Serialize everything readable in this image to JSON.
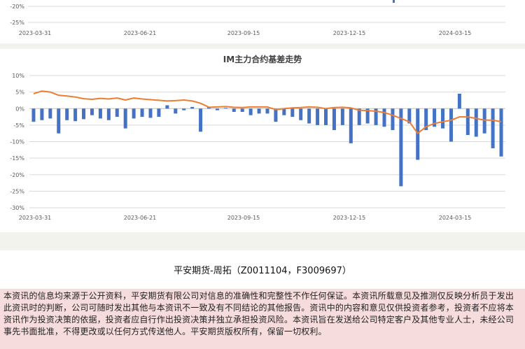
{
  "top_chart": {
    "ytick_labels": [
      "-20%",
      "-25%"
    ],
    "xtick_labels": [
      "2023-03-31",
      "2023-06-21",
      "2023-09-15",
      "2023-12-15",
      "2024-03-15"
    ]
  },
  "chart_data": {
    "type": "bar",
    "title": "IM主力合约基差走势",
    "xlabel": "",
    "ylabel": "",
    "ylim": [
      -30,
      10
    ],
    "grid": true,
    "ytick_labels": [
      "10%",
      "5%",
      "0%",
      "-5%",
      "-10%",
      "-15%",
      "-20%",
      "-25%",
      "-30%"
    ],
    "xtick_labels": [
      "2023-03-31",
      "2023-06-21",
      "2023-09-15",
      "2023-12-15",
      "2024-03-15"
    ],
    "series": [
      {
        "type": "bar",
        "color": "#4472c4",
        "values": [
          -4.0,
          -3.5,
          -3.0,
          -7.5,
          -3.5,
          -3.8,
          -3.2,
          -2.0,
          -3.0,
          -3.5,
          -2.5,
          -6.0,
          -3.0,
          -2.5,
          -2.8,
          -2.5,
          1.0,
          -1.5,
          -0.5,
          0.5,
          -7.0,
          0.5,
          -0.5,
          0.2,
          -1.0,
          -1.0,
          -2.0,
          -1.5,
          -1.5,
          -4.0,
          -2.0,
          -2.5,
          -3.5,
          -4.5,
          -5.0,
          -5.0,
          -6.5,
          -5.0,
          -10.5,
          -5.0,
          -4.5,
          -5.0,
          -5.5,
          -6.5,
          -23.5,
          -4.5,
          -15.5,
          -6.5,
          -5.5,
          -6.0,
          -10.0,
          4.5,
          -8.0,
          -8.5,
          -7.5,
          -12.0,
          -14.5
        ]
      },
      {
        "type": "line",
        "color": "#ed7d31",
        "values": [
          4.5,
          5.3,
          5.0,
          4.0,
          3.8,
          3.5,
          3.0,
          2.8,
          3.1,
          2.9,
          3.2,
          2.6,
          3.2,
          2.9,
          2.7,
          2.5,
          2.3,
          2.4,
          2.6,
          2.3,
          1.6,
          0.4,
          0.5,
          0.6,
          0.4,
          0.3,
          0.5,
          0.5,
          0.5,
          -0.3,
          0.0,
          0.2,
          0.3,
          0.5,
          0.4,
          0.0,
          0.3,
          0.4,
          0.2,
          -0.5,
          -0.6,
          -0.8,
          -1.2,
          -2.0,
          -3.0,
          -4.0,
          -7.5,
          -5.5,
          -4.5,
          -4.0,
          -3.5,
          -2.5,
          -2.5,
          -3.0,
          -3.5,
          -3.5,
          -4.0
        ]
      }
    ]
  },
  "footer": {
    "author": "平安期货-周拓（Z0011104，F3009697）",
    "disclaimer": "本资讯的信息均来源于公开资料，平安期货有限公司对信息的准确性和完整性不作任何保证。本资讯所载意见及推测仅反映分析员于发出此资讯时的判断，公司可随时发出其他与本资讯不一致及有不同结论的其他报告。资讯中的内容和意见仅供投资者参考，投资者不应将本资讯作为投资决策的依据，投资者应自行作出投资决策并独立承担投资风险。本资讯旨在发送给公司特定客户及其他专业人士，未经公司事先书面批准，不得更改或以任何方式传送他人。平安期货版权所有，保留一切权利。"
  }
}
